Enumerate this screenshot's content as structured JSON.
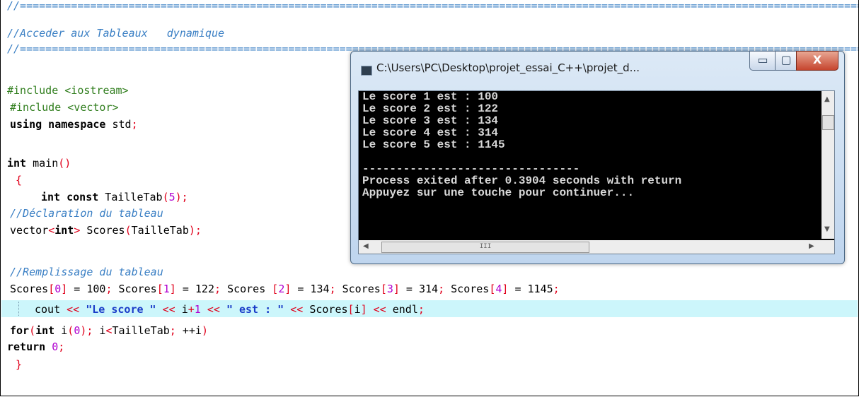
{
  "editor": {
    "separator": "//======================================================================================================================================",
    "comment_title": "//Acceder aux Tableaux   dynamique",
    "include_iostream": "#include <iostream>",
    "include_vector": "#include <vector>",
    "using_kw": "using namespace",
    "using_rest": " std",
    "int_kw": "int",
    "main_name": " main",
    "brace_open": "{",
    "const_decl_kw": "int const",
    "const_decl_name": " TailleTab",
    "const_decl_val": "5",
    "comment_decl": "//Déclaration du tableau",
    "vector_name": "vector",
    "vector_type": "int",
    "vector_var": " Scores",
    "vector_arg": "TailleTab",
    "comment_fill": "//Remplissage du tableau",
    "assign": [
      {
        "pre": "Scores",
        "idx": "0",
        "val": "100"
      },
      {
        "pre": "Scores",
        "idx": "1",
        "val": "122"
      },
      {
        "pre": "Scores ",
        "idx": "2",
        "val": "134"
      },
      {
        "pre": "Scores",
        "idx": "3",
        "val": "314"
      },
      {
        "pre": "Scores",
        "idx": "4",
        "val": "1145"
      }
    ],
    "for_kw": "for",
    "for_int": "int",
    "for_var": " i",
    "for_zero": "0",
    "for_cond": " i",
    "for_limit": "TailleTab",
    "for_incr": " ++i",
    "cout_name": "cout",
    "string_score": "\"Le score \"",
    "expr_i": " i",
    "expr_plus": "+",
    "expr_one": "1",
    "string_est": "\" est : \"",
    "scores_i_pre": " Scores",
    "scores_i_idx": "i",
    "endl": " endl",
    "return_kw": "return",
    "return_val": "0",
    "brace_close": "}"
  },
  "console": {
    "title": "C:\\Users\\PC\\Desktop\\projet_essai_C++\\projet_d...",
    "minimize_glyph": "▭",
    "maximize_glyph": "▢",
    "close_glyph": "X",
    "lines": [
      "Le score 1 est : 100",
      "Le score 2 est : 122",
      "Le score 3 est : 134",
      "Le score 4 est : 314",
      "Le score 5 est : 1145",
      "",
      "--------------------------------",
      "Process exited after 0.3904 seconds with return",
      "Appuyez sur une touche pour continuer..."
    ],
    "hscroll_grip": "III"
  }
}
